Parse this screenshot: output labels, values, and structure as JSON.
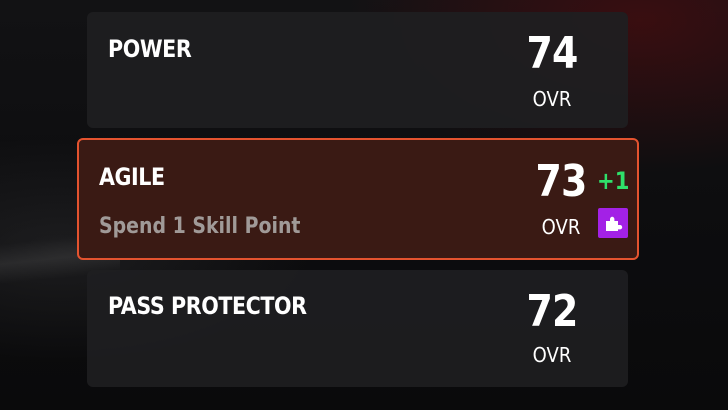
{
  "archetypes": [
    {
      "name": "POWER",
      "rating": "74",
      "rating_label": "OVR"
    },
    {
      "name": "AGILE",
      "rating": "73",
      "rating_label": "OVR",
      "subtitle": "Spend 1 Skill Point",
      "boost": "+1",
      "icon": "puzzle-piece-icon"
    },
    {
      "name": "PASS PROTECTOR",
      "rating": "72",
      "rating_label": "OVR"
    }
  ],
  "colors": {
    "selected_border": "#e4532f",
    "boost_text": "#2fe06a",
    "skill_icon_bg": "#a321e6"
  }
}
